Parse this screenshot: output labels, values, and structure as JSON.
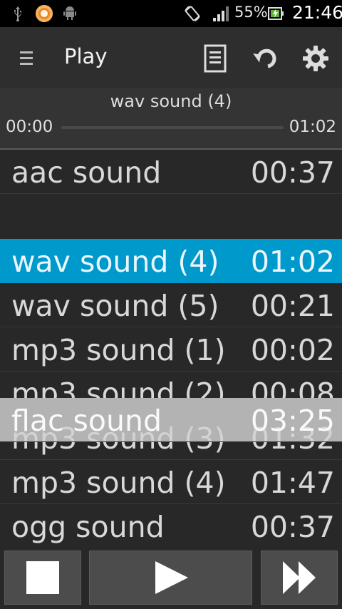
{
  "status_bar": {
    "battery": "55%",
    "time": "21:46"
  },
  "action_bar": {
    "title": "Play"
  },
  "now_playing": {
    "title": "wav sound (4)",
    "current": "00:00",
    "duration": "01:02",
    "progress": 0.0
  },
  "tracks": [
    {
      "name": "aac sound",
      "duration": "00:37"
    },
    {
      "name": "wav sound (4)",
      "duration": "01:02"
    },
    {
      "name": "wav sound (5)",
      "duration": "00:21"
    },
    {
      "name": "mp3 sound (1)",
      "duration": "00:02"
    },
    {
      "name": "mp3 sound (2)",
      "duration": "00:08"
    },
    {
      "name": "mp3 sound (3)",
      "duration": "01:32"
    },
    {
      "name": "mp3 sound (4)",
      "duration": "01:47"
    },
    {
      "name": "ogg sound",
      "duration": "00:37"
    }
  ],
  "dragging": {
    "name": "flac sound",
    "duration": "03:25"
  },
  "colors": {
    "accent": "#0099cc",
    "background": "#282828",
    "actionbar": "#2e2e2e"
  }
}
